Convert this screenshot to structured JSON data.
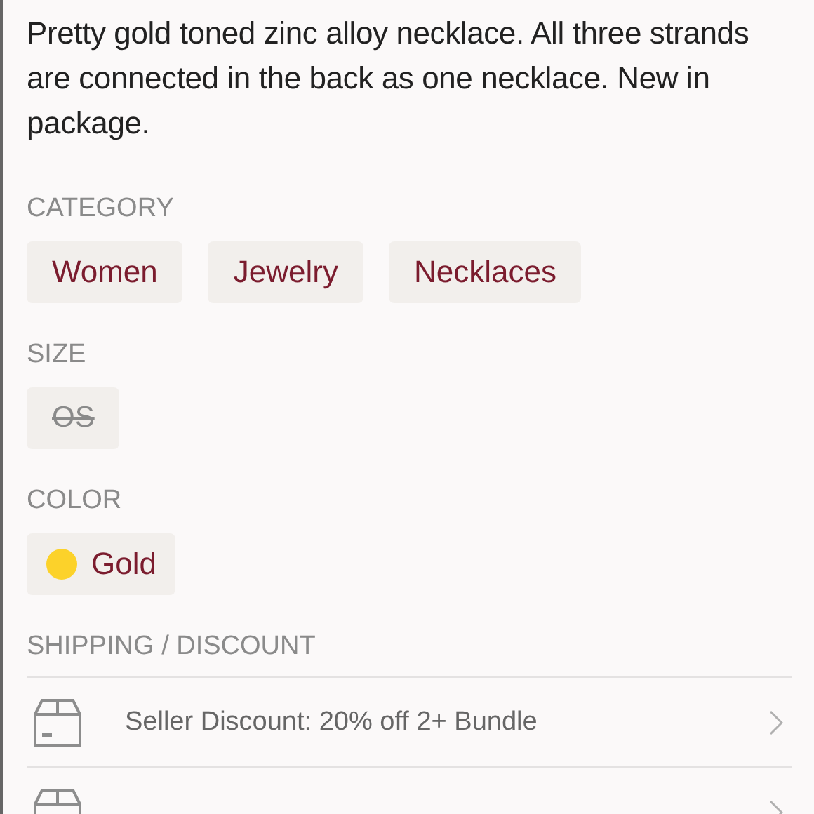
{
  "description": "Pretty gold toned zinc alloy necklace. All three strands are connected in the back as one necklace. New in package.",
  "sections": [
    {
      "kind": "tags",
      "title": "CATEGORY",
      "items": [
        {
          "label": "Women"
        },
        {
          "label": "Jewelry"
        },
        {
          "label": "Necklaces"
        }
      ]
    },
    {
      "kind": "size",
      "title": "SIZE",
      "items": [
        {
          "label": "OS",
          "available": false
        }
      ]
    },
    {
      "kind": "color",
      "title": "COLOR",
      "items": [
        {
          "label": "Gold",
          "color": "#fcd22a"
        }
      ]
    }
  ],
  "shipping": {
    "title": "SHIPPING / DISCOUNT",
    "rows": [
      {
        "text": "Seller Discount: 20% off 2+ Bundle"
      },
      {}
    ]
  }
}
